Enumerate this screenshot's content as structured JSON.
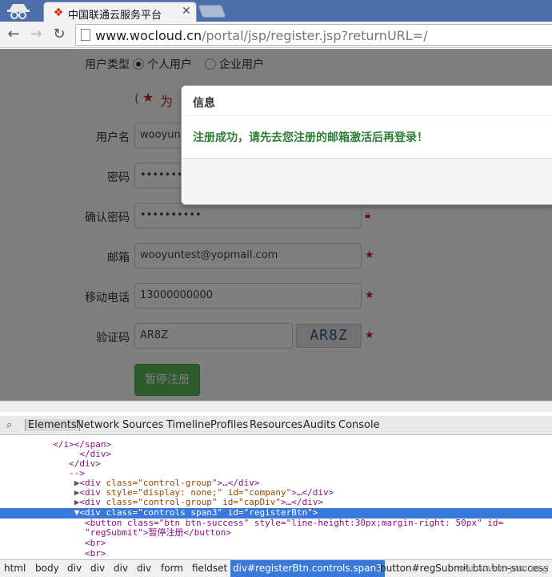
{
  "browser": {
    "tab_title": "中国联通云服务平台",
    "tab_close": "✕",
    "favicon": "unicom-logo-icon",
    "url_domain": "www.wocloud.cn",
    "url_path": "/portal/jsp/register.jsp?returnURL=/"
  },
  "form": {
    "user_type_label": "用户类型",
    "personal_user": "个人用户",
    "enterprise_user": "企业用户",
    "notice_partial": "为",
    "username_label": "用户名",
    "username_value": "wooyunt",
    "password_label": "密码",
    "password_value": "•••••••••",
    "confirm_label": "确认密码",
    "confirm_value": "••••••••••",
    "email_label": "邮箱",
    "email_value": "wooyuntest@yopmail.com",
    "phone_label": "移动电话",
    "phone_value": "13000000000",
    "captcha_label": "验证码",
    "captcha_value": "AR8Z",
    "captcha_image_text": "AR8Z",
    "required_mark": "★",
    "pause_button": "暂停注册"
  },
  "modal": {
    "title": "信息",
    "message": "注册成功，请先去您注册的邮箱激活后再登录！"
  },
  "devtools": {
    "tabs": [
      "Elements",
      "Network",
      "Sources",
      "Timeline",
      "Profiles",
      "Resources",
      "Audits",
      "Console"
    ],
    "code_lines": [
      {
        "indent": "          ",
        "text": "</i></span>",
        "kind": "plain"
      },
      {
        "indent": "               ",
        "text": "</div>",
        "kind": "plain"
      },
      {
        "indent": "             ",
        "text": "</div>",
        "kind": "plain"
      },
      {
        "indent": "             ",
        "text": "-->",
        "kind": "plain"
      }
    ],
    "nodes": [
      {
        "tri": "▶",
        "open": "<div ",
        "attrs": "class=\"control-group\"",
        "rest": ">…</div>"
      },
      {
        "tri": "▶",
        "open": "<div ",
        "attrs": "style=\"display: none;\" id=\"company\"",
        "rest": ">…</div>"
      },
      {
        "tri": "▶",
        "open": "<div ",
        "attrs": "class=\"control-group\" id=\"capDiv\"",
        "rest": ">…</div>"
      },
      {
        "tri": "▼",
        "open": "<div ",
        "attrs": "class=\"controls span3\" id=\"registerBtn\"",
        "rest": ">"
      }
    ],
    "button_line_1": "<button class=\"btn btn-success\" style=\"line-height:30px;margin-right: 50px\" id=",
    "button_line_2": "\"regSubmit\">暂停注册</button>",
    "br_1": "<br>",
    "br_2": "<br>",
    "breadcrumbs": [
      "html",
      "body",
      "div",
      "div",
      "div",
      "div",
      "form",
      "fieldset",
      "div#registerBtn.controls.span3",
      "button#regSubmit.btn.btn-success"
    ],
    "selected_crumb": 8
  },
  "watermark": "www.wooyun.org"
}
